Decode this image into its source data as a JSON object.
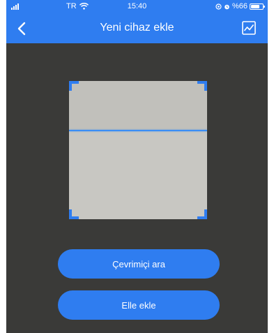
{
  "status_bar": {
    "carrier": "TR",
    "time": "15:40",
    "battery": "%66",
    "battery_level": 0.66
  },
  "header": {
    "title": "Yeni cihaz ekle",
    "back_icon": "chevron-left-icon",
    "gallery_icon": "image-gallery-icon"
  },
  "buttons": {
    "online_search_label": "Çevrimiçi ara",
    "manual_add_label": "Elle ekle"
  },
  "colors": {
    "accent": "#2f7df0",
    "scan_line": "#3a8ef5",
    "background": "#3a3a38"
  }
}
